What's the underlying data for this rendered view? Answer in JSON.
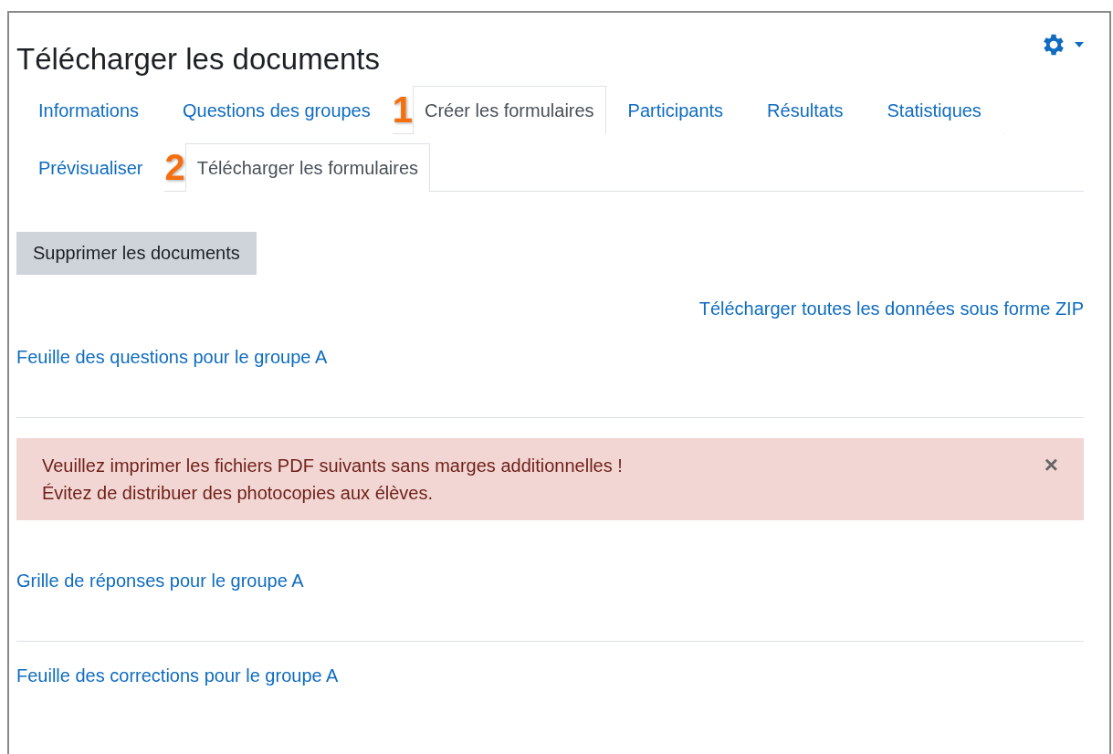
{
  "page": {
    "title": "Télécharger les documents"
  },
  "tabs": [
    {
      "label": "Informations",
      "selected": false
    },
    {
      "label": "Questions des groupes",
      "selected": false
    },
    {
      "label": "Créer les formulaires",
      "selected": true,
      "marker": "1"
    },
    {
      "label": "Participants",
      "selected": false
    },
    {
      "label": "Résultats",
      "selected": false
    },
    {
      "label": "Statistiques",
      "selected": false
    }
  ],
  "subtabs": [
    {
      "label": "Prévisualiser",
      "selected": false
    },
    {
      "label": "Télécharger les formulaires",
      "selected": true,
      "marker": "2"
    }
  ],
  "delete_button": "Supprimer les documents",
  "zip_link": "Télécharger toutes les données sous forme ZIP",
  "blocks": [
    {
      "kind": "link",
      "text": "Feuille des questions pour le groupe A"
    },
    {
      "kind": "alert",
      "lines": [
        "Veuillez imprimer les fichiers PDF suivants sans marges additionnelles !",
        "Évitez de distribuer des photocopies aux élèves."
      ],
      "close": "×"
    },
    {
      "kind": "link",
      "text": "Grille de réponses pour le groupe A"
    },
    {
      "kind": "link",
      "text": "Feuille des corrections pour le groupe A"
    }
  ]
}
